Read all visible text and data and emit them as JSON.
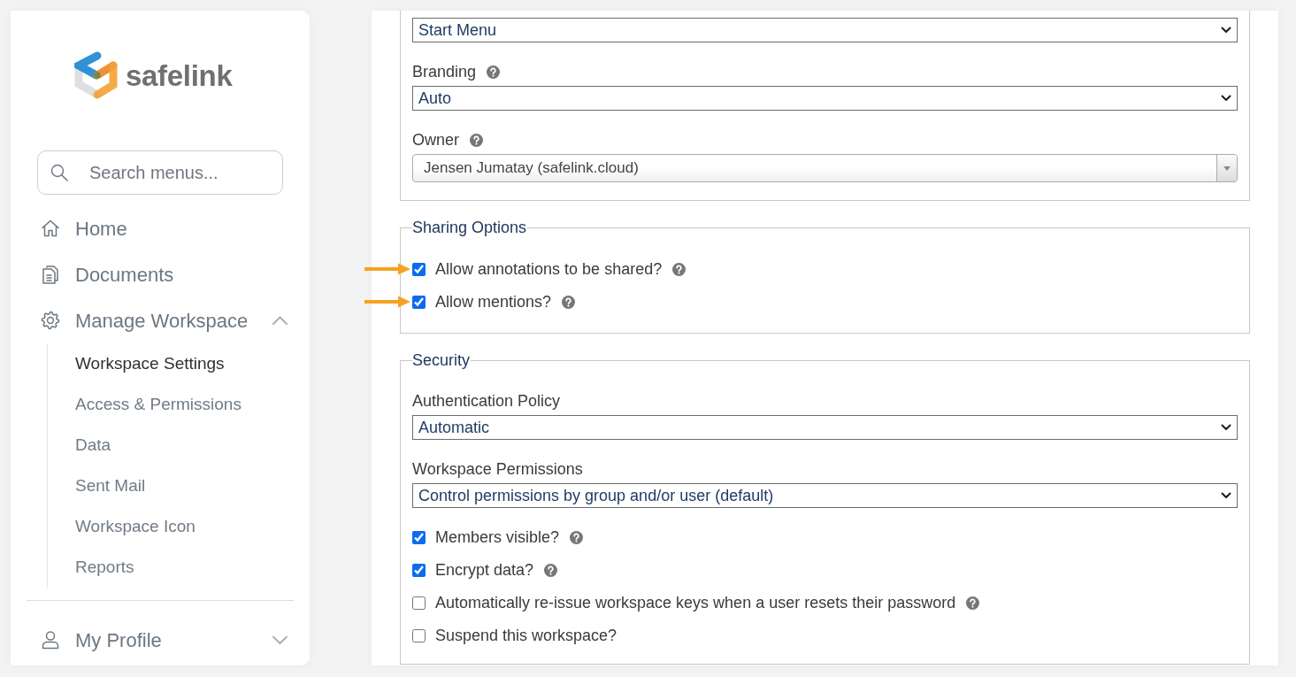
{
  "sidebar": {
    "logo": {
      "text": "safelink"
    },
    "search": {
      "placeholder": "Search menus..."
    },
    "nav": [
      {
        "kind": "link",
        "label": "Home"
      },
      {
        "kind": "link",
        "label": "Documents"
      },
      {
        "kind": "group",
        "label": "Manage Workspace",
        "expanded": true,
        "children": [
          {
            "label": "Workspace Settings",
            "selected": true
          },
          {
            "label": "Access & Permissions",
            "selected": false
          },
          {
            "label": "Data",
            "selected": false
          },
          {
            "label": "Sent Mail",
            "selected": false
          },
          {
            "label": "Workspace Icon",
            "selected": false
          },
          {
            "label": "Reports",
            "selected": false
          }
        ]
      }
    ],
    "account_nav": [
      {
        "kind": "group",
        "label": "My Profile",
        "expanded": false
      }
    ]
  },
  "main": {
    "general": {
      "fields": [
        {
          "kind": "select",
          "value": "Start Menu"
        },
        {
          "kind": "select",
          "label": "Branding",
          "help": true,
          "value": "Auto"
        },
        {
          "kind": "combo",
          "label": "Owner",
          "help": true,
          "value": "Jensen Jumatay (safelink.cloud)"
        }
      ]
    },
    "sharing_options": {
      "legend": "Sharing Options",
      "options": [
        {
          "label": "Allow annotations to be shared?",
          "checked": true,
          "help": true,
          "highlighted": true
        },
        {
          "label": "Allow mentions?",
          "checked": true,
          "help": true,
          "highlighted": true
        }
      ]
    },
    "security": {
      "legend": "Security",
      "fields": [
        {
          "kind": "select",
          "label": "Authentication Policy",
          "help": false,
          "value": "Automatic"
        },
        {
          "kind": "select",
          "label": "Workspace Permissions",
          "help": false,
          "value": "Control permissions by group and/or user (default)"
        }
      ],
      "options": [
        {
          "label": "Members visible?",
          "checked": true,
          "help": true,
          "highlighted": false
        },
        {
          "label": "Encrypt data?",
          "checked": true,
          "help": true,
          "highlighted": false
        },
        {
          "label": "Automatically re-issue workspace keys when a user resets their password",
          "checked": false,
          "help": true,
          "highlighted": false
        },
        {
          "label": "Suspend this workspace?",
          "checked": false,
          "help": false,
          "highlighted": false
        }
      ]
    }
  }
}
